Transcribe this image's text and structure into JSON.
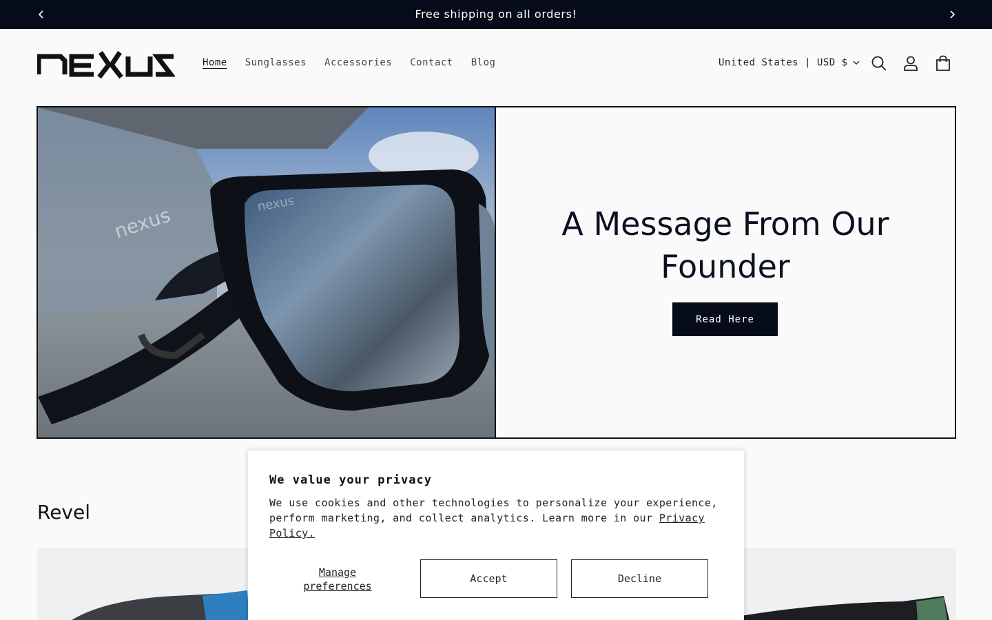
{
  "announcement": {
    "text": "Free shipping on all orders!"
  },
  "header": {
    "logo_text": "nexus",
    "nav": [
      "Home",
      "Sunglasses",
      "Accessories",
      "Contact",
      "Blog"
    ],
    "locale": "United States | USD $"
  },
  "hero": {
    "title": "A Message From Our Founder",
    "button": "Read Here"
  },
  "collection": {
    "title": "Revel"
  },
  "cookie": {
    "title": "We value your privacy",
    "body": "We use cookies and other technologies to personalize your experience, perform marketing, and collect analytics. Learn more in our",
    "link": "Privacy Policy.",
    "manage": "Manage preferences",
    "accept": "Accept",
    "decline": "Decline"
  },
  "colors": {
    "dark": "#050b18",
    "background": "#fafafa"
  }
}
